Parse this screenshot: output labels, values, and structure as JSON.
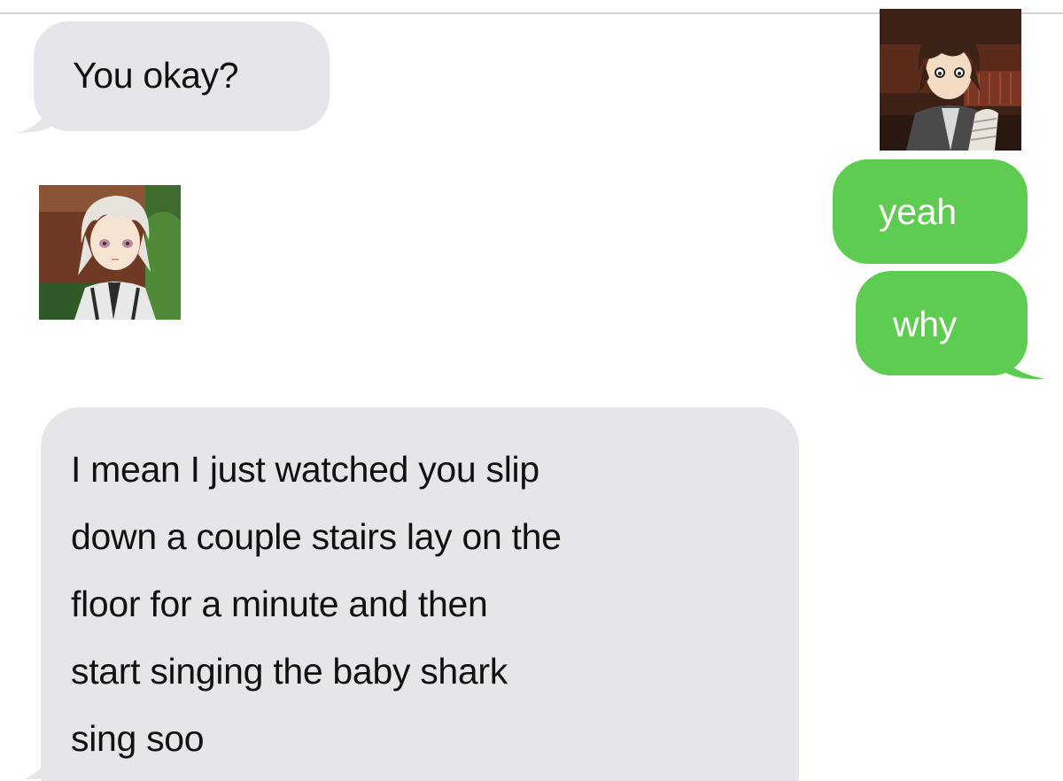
{
  "conversation": {
    "messages": [
      {
        "direction": "incoming",
        "text": "You okay?"
      },
      {
        "direction": "outgoing",
        "text": "yeah"
      },
      {
        "direction": "outgoing",
        "text": "why"
      },
      {
        "direction": "incoming",
        "lines": [
          "I mean I just watched you slip",
          "down a couple stairs lay on the",
          "floor for a minute and then",
          "start singing the baby shark",
          "sing soo"
        ]
      }
    ]
  },
  "colors": {
    "incoming_bubble": "#e6e6ea",
    "outgoing_bubble": "#5ecc50",
    "incoming_text": "#111111",
    "outgoing_text": "#ffffff"
  }
}
